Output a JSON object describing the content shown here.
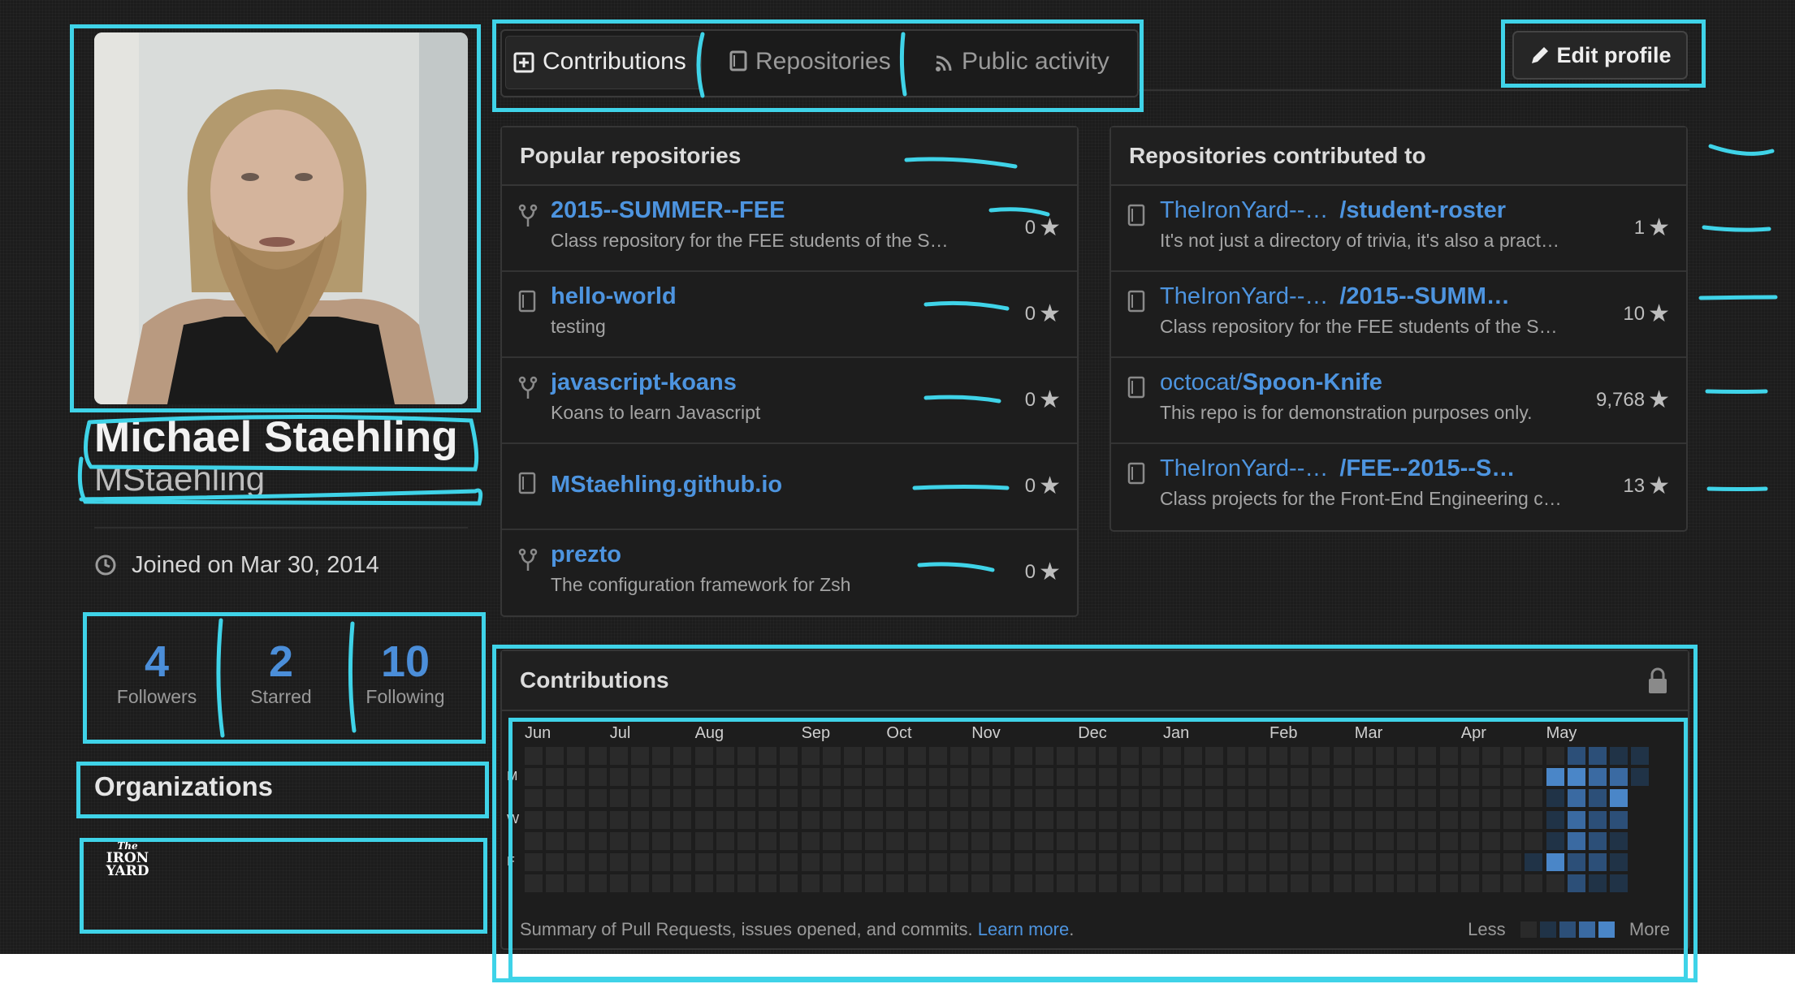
{
  "profile": {
    "full_name": "Michael Staehling",
    "username": "MStaehling",
    "joined": "Joined on Mar 30, 2014"
  },
  "stats": [
    {
      "value": "4",
      "label": "Followers"
    },
    {
      "value": "2",
      "label": "Starred"
    },
    {
      "value": "10",
      "label": "Following"
    }
  ],
  "organizations": {
    "title": "Organizations",
    "logo_text": [
      "The",
      "IRON",
      "YARD"
    ]
  },
  "tabs": [
    {
      "label": "Contributions",
      "icon": "plus-square-icon",
      "active": true
    },
    {
      "label": "Repositories",
      "icon": "repo-book-icon",
      "active": false
    },
    {
      "label": "Public activity",
      "icon": "rss-icon",
      "active": false
    }
  ],
  "edit_profile": {
    "label": "Edit profile",
    "icon": "pencil-icon"
  },
  "popular": {
    "title": "Popular repositories",
    "items": [
      {
        "icon": "fork-icon",
        "name": "2015--SUMMER--FEE",
        "desc": "Class repository for the FEE students of the S…",
        "stars": "0"
      },
      {
        "icon": "repo-book-icon",
        "name": "hello-world",
        "desc": "testing",
        "stars": "0"
      },
      {
        "icon": "fork-icon",
        "name": "javascript-koans",
        "desc": "Koans to learn Javascript",
        "stars": "0"
      },
      {
        "icon": "repo-book-icon",
        "name": "MStaehling.github.io",
        "desc": "",
        "stars": "0"
      },
      {
        "icon": "fork-icon",
        "name": "prezto",
        "desc": "The configuration framework for Zsh",
        "stars": "0"
      }
    ]
  },
  "contributed": {
    "title": "Repositories contributed to",
    "items": [
      {
        "owner": "TheIronYard--…",
        "repo": "/student-roster",
        "desc": "It's not just a directory of trivia, it's also a pract…",
        "stars": "1"
      },
      {
        "owner": "TheIronYard--…",
        "repo": "/2015--SUMM…",
        "desc": "Class repository for the FEE students of the S…",
        "stars": "10"
      },
      {
        "owner": "octocat/",
        "repo": "Spoon-Knife",
        "desc": "This repo is for demonstration purposes only.",
        "stars": "9,768"
      },
      {
        "owner": "TheIronYard--…",
        "repo": "/FEE--2015--S…",
        "desc": "Class projects for the Front-End Engineering c…",
        "stars": "13"
      }
    ]
  },
  "contributions": {
    "title": "Contributions",
    "lock_icon": "lock-icon",
    "months": [
      "Jun",
      "Jul",
      "Aug",
      "Sep",
      "Oct",
      "Nov",
      "Dec",
      "Jan",
      "Feb",
      "Mar",
      "Apr",
      "May"
    ],
    "days": [
      "M",
      "W",
      "F"
    ],
    "summary_text": "Summary of Pull Requests, issues opened, and commits.",
    "learn_more": "Learn more",
    "legend_less": "Less",
    "legend_more": "More",
    "colors": [
      "#2a2a2a",
      "#203347",
      "#2c4f78",
      "#3a6aa2",
      "#4a86c8"
    ]
  }
}
